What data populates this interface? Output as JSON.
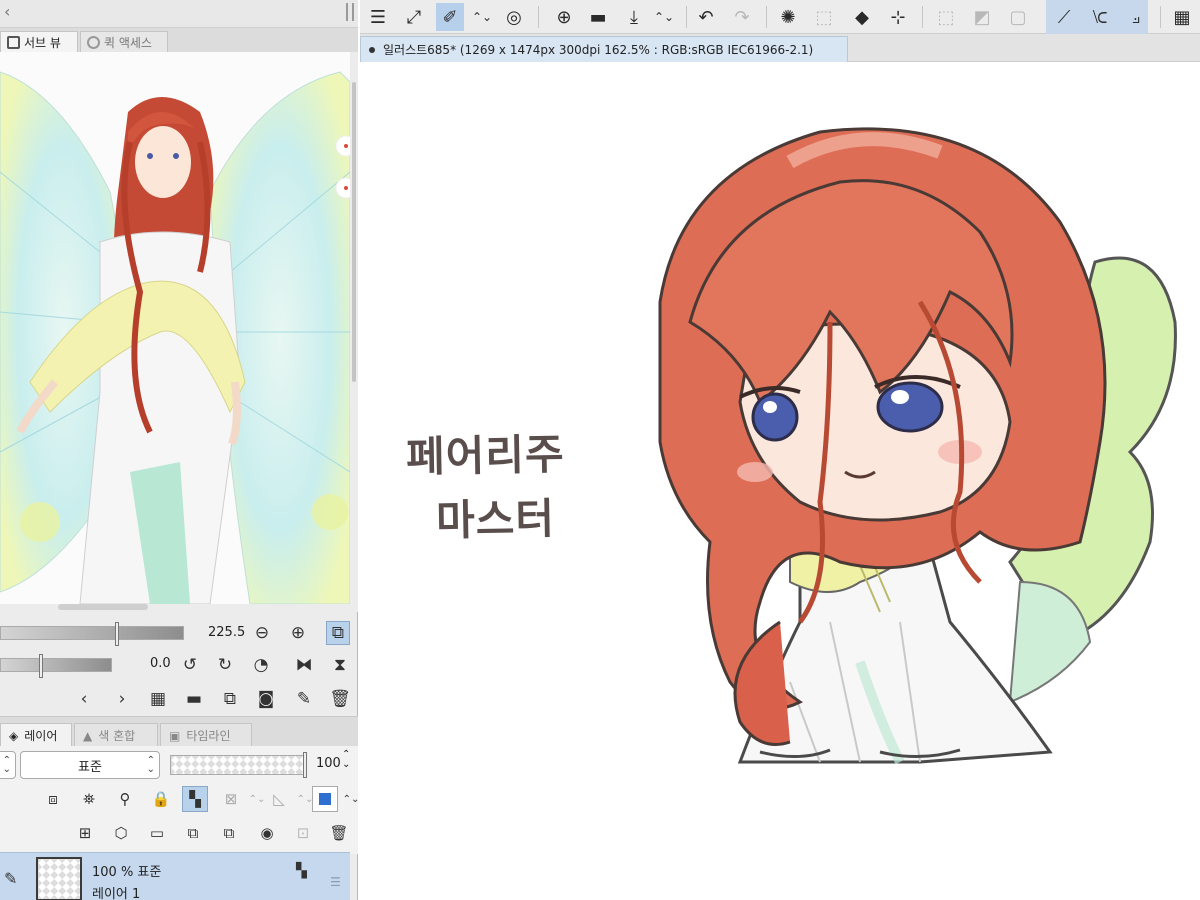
{
  "left_panel": {
    "tabs": [
      {
        "label": "서브 뷰",
        "icon": "image-icon",
        "active": true
      },
      {
        "label": "퀵 액세스",
        "icon": "quick-access-icon",
        "active": false
      }
    ],
    "zoom_value": "225.5",
    "rotation_value": "0.0",
    "layer_tabs": [
      {
        "label": "레이어",
        "active": true
      },
      {
        "label": "색 혼합",
        "active": false
      },
      {
        "label": "타임라인",
        "active": false
      }
    ],
    "blend_mode": "표준",
    "opacity": "100",
    "layer": {
      "opacity_mode": "100 %  표준",
      "name": "레이어 1"
    }
  },
  "document": {
    "tab_title": "일러스트685* (1269 x 1474px 300dpi 162.5% : RGB:sRGB IEC61966-2.1)"
  },
  "canvas": {
    "handwriting_line1": "페어리주",
    "handwriting_line2": "마스터"
  },
  "colors": {
    "hair": "#d9604a",
    "eye": "#4a5ba8",
    "wing": "#c8efa0",
    "scarf": "#f0f0a8",
    "selection": "#c5d8ee",
    "toolbar_active": "#b6cfea"
  }
}
